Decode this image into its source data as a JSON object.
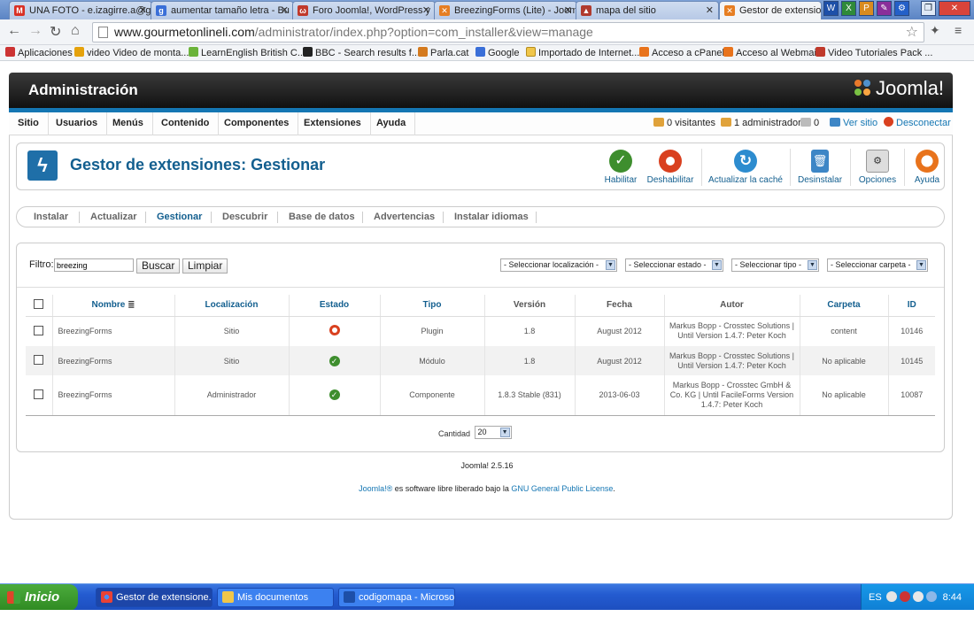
{
  "browser": {
    "tabs": [
      {
        "label": "UNA FOTO - e.izagirre.a@g",
        "fav": "M",
        "color": "#d93025"
      },
      {
        "label": "aumentar tamaño letra - Bu",
        "fav": "g",
        "color": "#3a6fd8"
      },
      {
        "label": "Foro Joomla!, WordPress y",
        "fav": "ω",
        "color": "#c0392b"
      },
      {
        "label": "BreezingForms (Lite) - Joom",
        "fav": "✕",
        "color": "#e67e22"
      },
      {
        "label": "mapa del sitio",
        "fav": "▲",
        "color": "#b03a2e"
      },
      {
        "label": "Gestor de extensio",
        "fav": "✕",
        "color": "#e67e22"
      }
    ],
    "url_host": "www.gourmetonlineli.com",
    "url_path": "/administrator/index.php?option=com_installer&view=manage",
    "bookmarks": [
      "Aplicaciones",
      "video Video de monta...",
      "LearnEnglish British C...",
      "BBC - Search results f...",
      "Parla.cat",
      "Google",
      "Importado de Internet...",
      "Acceso a cPanel",
      "Acceso al Webmail",
      "Video Tutoriales Pack ..."
    ]
  },
  "admin": {
    "title": "Administración",
    "logo": "Joomla!",
    "menu": [
      "Sitio",
      "Usuarios",
      "Menús",
      "Contenido",
      "Componentes",
      "Extensiones",
      "Ayuda"
    ],
    "status": {
      "visitors": "0 visitantes",
      "admins": "1 administrador",
      "messages": "0",
      "view_site": "Ver sitio",
      "logout": "Desconectar"
    }
  },
  "toolbar": {
    "page_title": "Gestor de extensiones: Gestionar",
    "buttons": [
      "Habilitar",
      "Deshabilitar",
      "Actualizar la caché",
      "Desinstalar",
      "Opciones",
      "Ayuda"
    ]
  },
  "subtabs": [
    "Instalar",
    "Actualizar",
    "Gestionar",
    "Descubrir",
    "Base de datos",
    "Advertencias",
    "Instalar idiomas"
  ],
  "filter": {
    "label": "Filtro:",
    "value": "breezing",
    "search_btn": "Buscar",
    "clear_btn": "Limpiar",
    "selects": [
      "- Seleccionar localización -",
      "- Seleccionar estado -",
      "- Seleccionar tipo -",
      "- Seleccionar carpeta -"
    ]
  },
  "table": {
    "headers": [
      "Nombre",
      "Localización",
      "Estado",
      "Tipo",
      "Versión",
      "Fecha",
      "Autor",
      "Carpeta",
      "ID"
    ],
    "rows": [
      {
        "name": "BreezingForms",
        "location": "Sitio",
        "status": "disabled",
        "type": "Plugin",
        "version": "1.8",
        "date": "August 2012",
        "author": "Markus Bopp - Crosstec Solutions | Until Version 1.4.7: Peter Koch",
        "folder": "content",
        "id": "10146"
      },
      {
        "name": "BreezingForms",
        "location": "Sitio",
        "status": "enabled",
        "type": "Módulo",
        "version": "1.8",
        "date": "August 2012",
        "author": "Markus Bopp - Crosstec Solutions | Until Version 1.4.7: Peter Koch",
        "folder": "No aplicable",
        "id": "10145"
      },
      {
        "name": "BreezingForms",
        "location": "Administrador",
        "status": "enabled",
        "type": "Componente",
        "version": "1.8.3 Stable (831)",
        "date": "2013-06-03",
        "author": "Markus Bopp - Crosstec GmbH & Co. KG | Until FacileForms Version 1.4.7: Peter Koch",
        "folder": "No aplicable",
        "id": "10087"
      }
    ],
    "cantidad_label": "Cantidad",
    "cantidad_value": "20"
  },
  "footer": {
    "version": "Joomla! 2.5.16",
    "license_pre": "Joomla!®",
    "license_mid": " es software libre liberado bajo la ",
    "license_link": "GNU General Public License",
    "license_end": "."
  },
  "taskbar": {
    "start": "Inicio",
    "tasks": [
      "Gestor de extensione...",
      "Mis documentos",
      "codigomapa - Microso..."
    ],
    "lang": "ES",
    "clock": "8:44"
  }
}
